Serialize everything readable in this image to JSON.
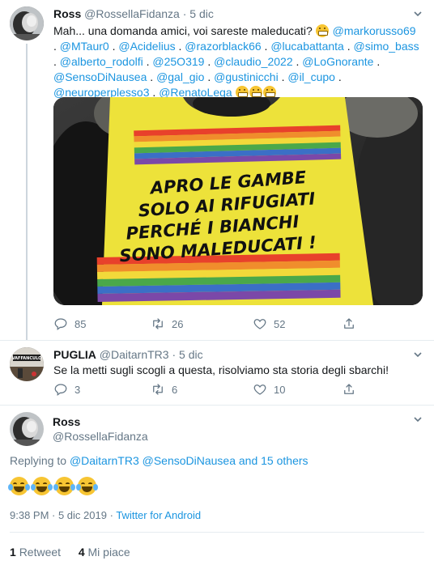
{
  "tweet1": {
    "name": "Ross",
    "handle": "@RossellaFidanza",
    "dot": "·",
    "date": "5 dic",
    "text_lead": "Mah... una domanda amici, voi sareste maleducati?",
    "mentions": [
      "@markorusso69",
      "@MTaur0",
      "@Acidelius",
      "@razorblack66",
      "@lucabattanta",
      "@simo_bass",
      "@alberto_rodolfi",
      "@25O319",
      "@claudio_2022",
      "@LoGnorante",
      "@SensoDiNausea",
      "@gal_gio",
      "@gustinicchi",
      "@il_cupo",
      "@neuroperplesso3",
      "@RenatoLega"
    ],
    "sep": ".",
    "image": {
      "sign_lines": [
        "APRO LE GAMBE",
        "SOLO AI RIFUGIATI",
        "PERCHÉ  I BIANCHI",
        "SONO MALEDUCATI !"
      ]
    },
    "replies": "85",
    "retweets": "26",
    "likes": "52"
  },
  "tweet2": {
    "name": "PUGLIA",
    "handle": "@DaitarnTR3",
    "dot": "·",
    "date": "5 dic",
    "text": "Se la metti sugli scogli a questa, risolviamo sta storia degli sbarchi!",
    "avatar_text": "VAFFANCULO",
    "replies": "3",
    "retweets": "6",
    "likes": "10"
  },
  "tweet3": {
    "name": "Ross",
    "handle": "@RossellaFidanza",
    "replying_prefix": "Replying to",
    "replying_to": "@DaitarnTR3 @SensoDiNausea and 15 others",
    "time": "9:38 PM · 5 dic 2019",
    "source_sep": "·",
    "source": "Twitter for Android",
    "retweet_count": "1",
    "retweet_label": "Retweet",
    "like_count": "4",
    "like_label": "Mi piace"
  },
  "colors": {
    "link": "#1b95e0",
    "muted": "#657786",
    "text": "#14171a",
    "sign_yellow": "#ede23a"
  }
}
